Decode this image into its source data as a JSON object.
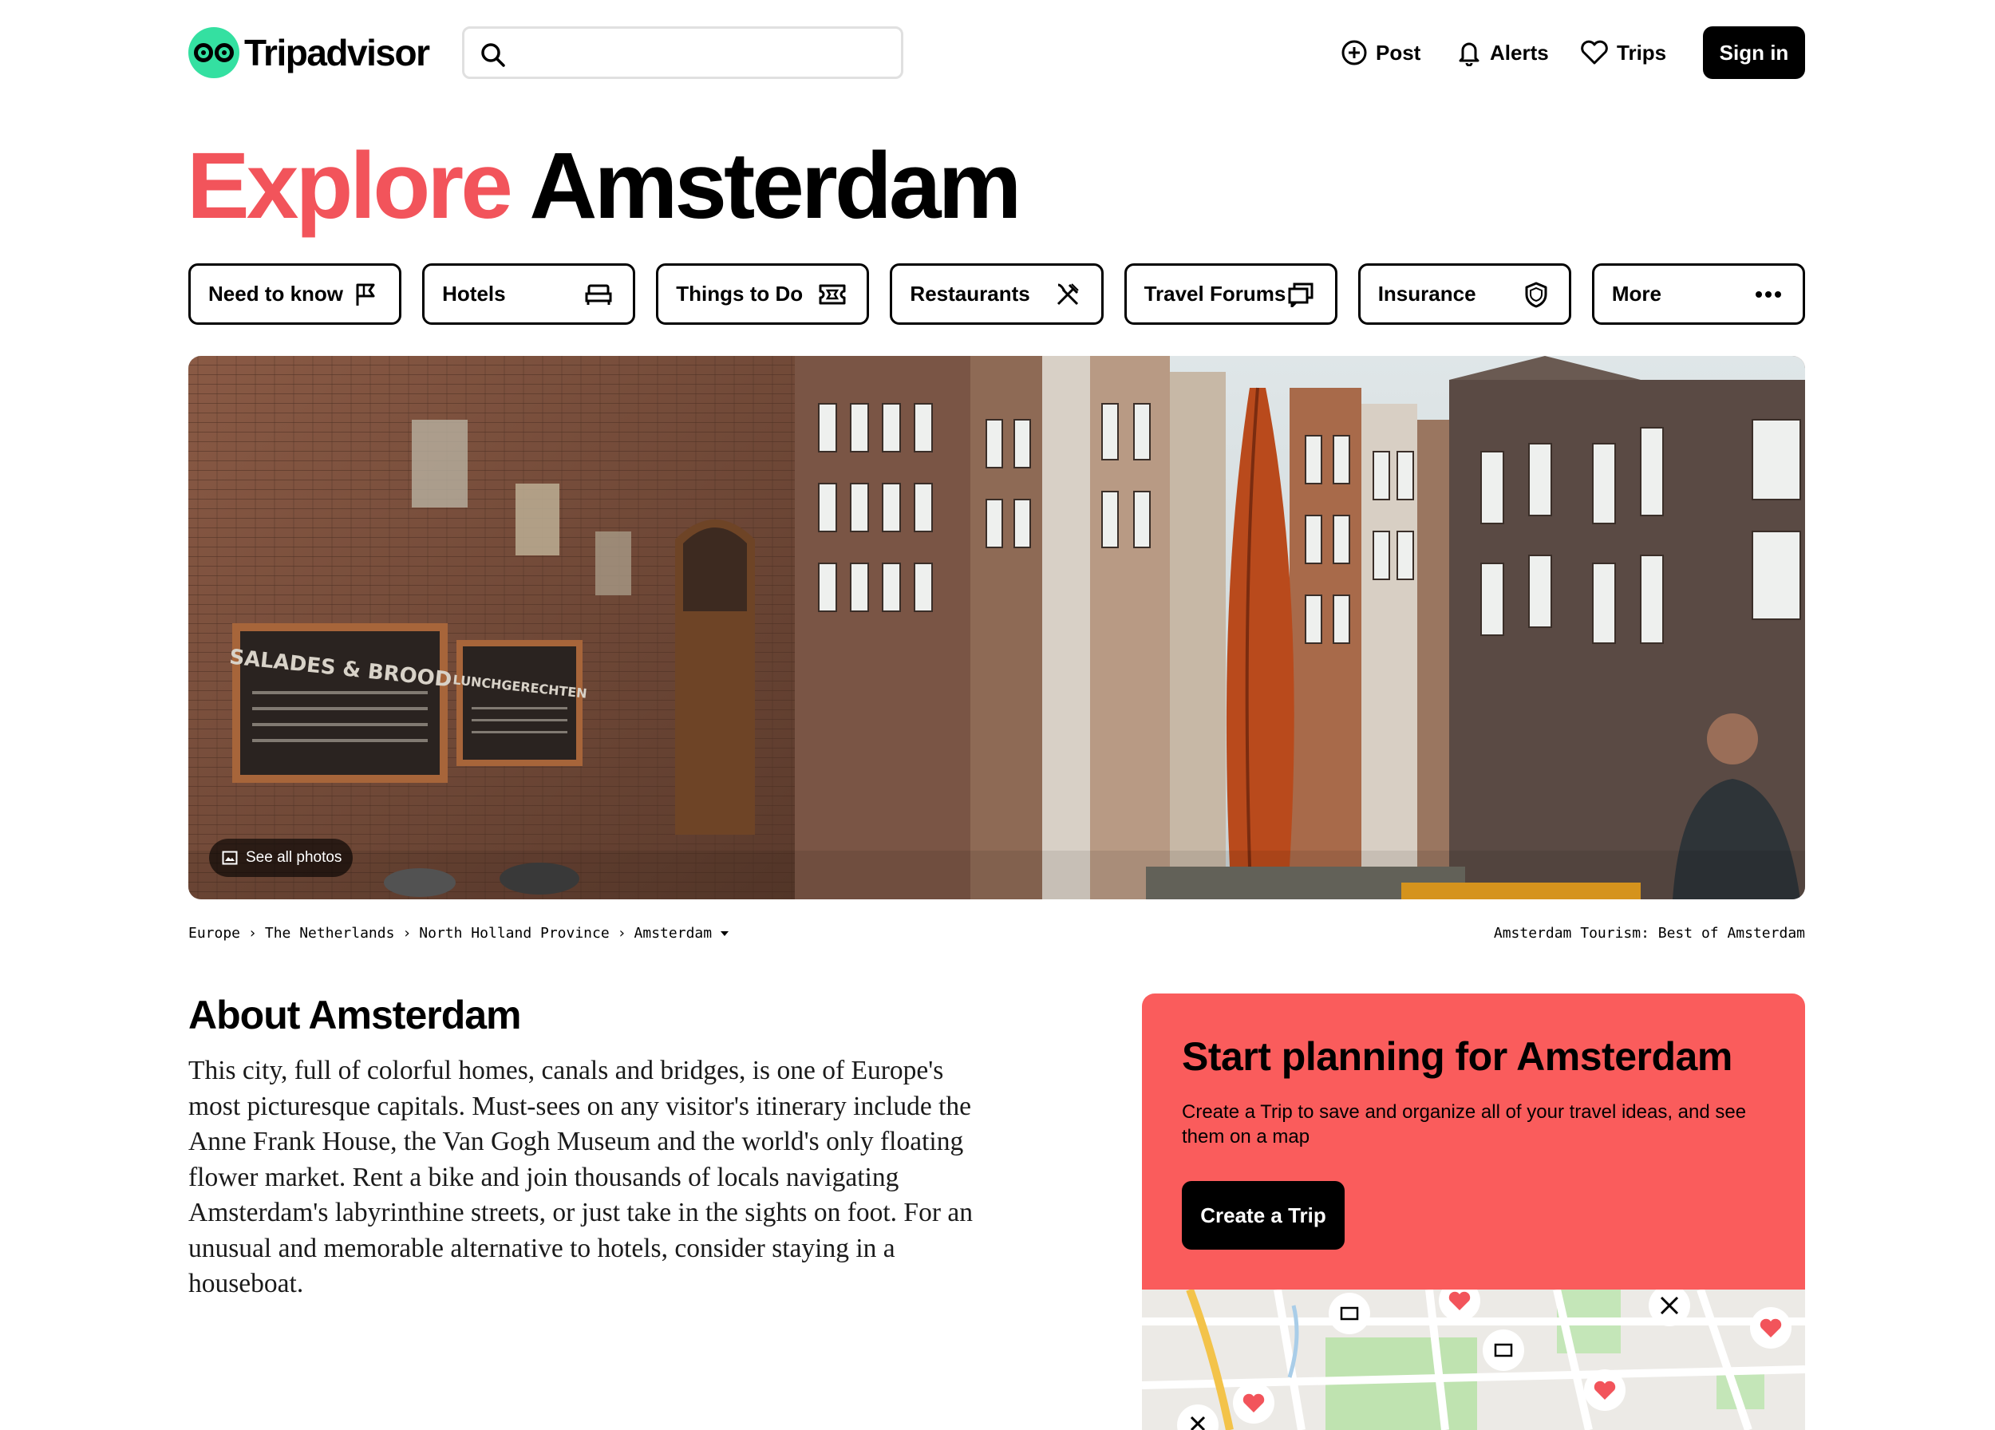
{
  "header": {
    "logo_text": "Tripadvisor",
    "search_placeholder": "",
    "nav": [
      {
        "label": "Post",
        "icon": "plus-circle-icon"
      },
      {
        "label": "Alerts",
        "icon": "bell-icon"
      },
      {
        "label": "Trips",
        "icon": "heart-icon"
      }
    ],
    "signin_label": "Sign in"
  },
  "hero": {
    "title_accent": "Explore",
    "title_rest": "Amsterdam"
  },
  "chips": [
    {
      "label": "Need to know",
      "icon": "flag-icon"
    },
    {
      "label": "Hotels",
      "icon": "bed-icon"
    },
    {
      "label": "Things to Do",
      "icon": "ticket-icon"
    },
    {
      "label": "Restaurants",
      "icon": "fork-knife-icon"
    },
    {
      "label": "Travel Forums",
      "icon": "chat-icon"
    },
    {
      "label": "Insurance",
      "icon": "shield-icon"
    },
    {
      "label": "More",
      "icon": "dots-icon"
    }
  ],
  "photo": {
    "see_all_label": "See all photos",
    "sign_text_1": "SALADES & BROOD",
    "sign_text_2": "LUNCHGERECHTEN"
  },
  "breadcrumbs": {
    "items": [
      "Europe",
      "The Netherlands",
      "North Holland Province",
      "Amsterdam"
    ],
    "tourism_text": "Amsterdam Tourism: Best of Amsterdam"
  },
  "about": {
    "title": "About Amsterdam",
    "body": "This city, full of colorful homes, canals and bridges, is one of Europe's most picturesque capitals. Must-sees on any visitor's itinerary include the Anne Frank House, the Van Gogh Museum and the world's only floating flower market. Rent a bike and join thousands of locals navigating Amsterdam's labyrinthine streets, or just take in the sights on foot. For an unusual and memorable alternative to hotels, consider staying in a houseboat."
  },
  "plan": {
    "title": "Start planning for Amsterdam",
    "description": "Create a Trip to save and organize all of your travel ideas, and see them on a map",
    "button_label": "Create a Trip"
  },
  "colors": {
    "brand_green": "#34e0a1",
    "accent_red": "#f2545b",
    "plan_bg": "#fa5c5c",
    "black": "#000000"
  }
}
